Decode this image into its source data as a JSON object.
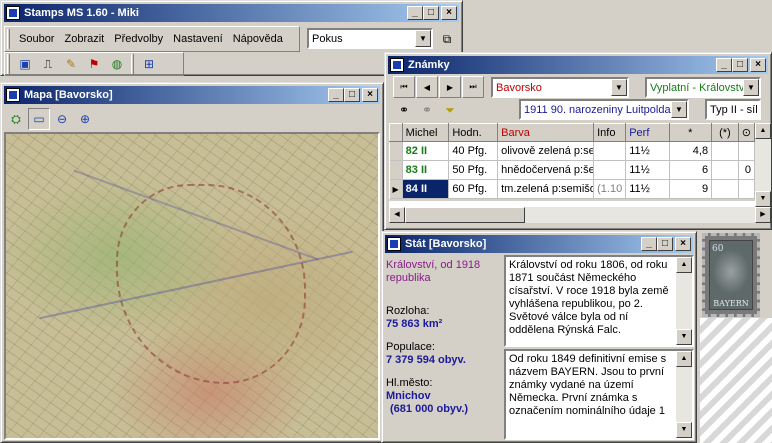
{
  "main": {
    "title": "Stamps MS 1.60 - Miki",
    "menu": [
      "Soubor",
      "Zobrazit",
      "Předvolby",
      "Nastavení",
      "Nápověda"
    ],
    "combo_value": "Pokus"
  },
  "mapa": {
    "title": "Mapa [Bavorsko]"
  },
  "znamky": {
    "title": "Známky",
    "country": "Bavorsko",
    "category": "Vyplatní - Království",
    "issue": "1911 90. narozeniny Luitpolda",
    "type": "Typ II - síl",
    "columns": [
      "Michel",
      "Hodn.",
      "Barva",
      "Info",
      "Perf",
      "*",
      "(*)",
      "⊙"
    ],
    "rows": [
      {
        "michel": "82 II",
        "hodn": "40 Pfg.",
        "barva": "olivově zelená p:sem",
        "info": "",
        "perf": "11½",
        "star": "4,8",
        "star2": "",
        "used": ""
      },
      {
        "michel": "83 II",
        "hodn": "50 Pfg.",
        "barva": "hnědočervená p:še",
        "info": "",
        "perf": "11½",
        "star": "6",
        "star2": "",
        "used": "0"
      },
      {
        "michel": "84 II",
        "hodn": "60 Pfg.",
        "barva": "tm.zelená p:semišov",
        "info": "(1.10",
        "perf": "11½",
        "star": "9",
        "star2": "",
        "used": ""
      }
    ]
  },
  "stat": {
    "title": "Stát [Bavorsko]",
    "status": "Království, od 1918 republika",
    "area_label": "Rozloha:",
    "area_value": "75 863 km²",
    "pop_label": "Populace:",
    "pop_value": "7 379 594 obyv.",
    "capital_label": "Hl.město:",
    "capital_value": "Mnichov",
    "capital_pop": "(681 000 obyv.)",
    "history": "Království od roku 1806, od roku 1871 součást Německého císařství. V roce 1918 byla země vyhlášena republikou, po 2. Světové válce byla od ní oddělena Rýnská Falc.",
    "stamps_note": "Od roku 1849 definitivní emise s názvem BAYERN. Jsou to první známky vydané na území Německa. První známka s označením nominálního údaje 1"
  },
  "stamp": {
    "value": "60",
    "name": "BAYERN"
  },
  "colors": {
    "title_start": "#0a246a",
    "title_end": "#a6caf0",
    "michel_green": "#1a7a1a",
    "red_text": "#c00000",
    "purple_text": "#8a1a8a"
  }
}
